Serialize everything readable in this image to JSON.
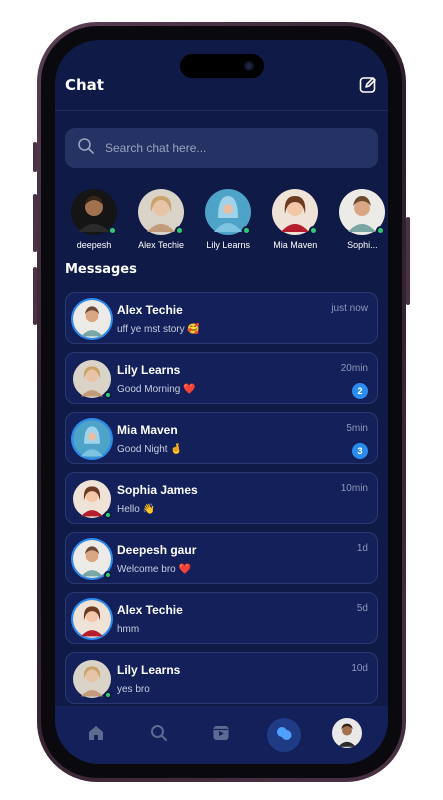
{
  "header": {
    "title": "Chat"
  },
  "search": {
    "placeholder": "Search chat here..."
  },
  "stories": [
    {
      "name": "deepesh",
      "online": true
    },
    {
      "name": "Alex Techie",
      "online": true
    },
    {
      "name": "Lily Learns",
      "online": true
    },
    {
      "name": "Mia Maven",
      "online": true
    },
    {
      "name": "Sophi...",
      "online": true
    }
  ],
  "messages_section": {
    "title": "Messages"
  },
  "messages": [
    {
      "name": "Alex Techie",
      "preview": "uff ye mst story 🥰",
      "time": "just now",
      "badge": ""
    },
    {
      "name": "Lily Learns",
      "preview": "Good Morning ❤️",
      "time": "20min",
      "badge": "2"
    },
    {
      "name": "Mia Maven",
      "preview": "Good Night 🤞",
      "time": "5min",
      "badge": "3"
    },
    {
      "name": "Sophia James",
      "preview": "Hello 👋",
      "time": "10min",
      "badge": ""
    },
    {
      "name": "Deepesh gaur",
      "preview": "Welcome bro ❤️",
      "time": "1d",
      "badge": ""
    },
    {
      "name": "Alex Techie",
      "preview": "hmm",
      "time": "5d",
      "badge": ""
    },
    {
      "name": "Lily Learns",
      "preview": "yes bro",
      "time": "10d",
      "badge": ""
    }
  ],
  "nav": [
    {
      "icon": "home-icon"
    },
    {
      "icon": "search-icon"
    },
    {
      "icon": "reels-icon"
    },
    {
      "icon": "chat-icon",
      "active": true
    },
    {
      "icon": "profile-avatar"
    }
  ],
  "colors": {
    "background": "#0f1a47",
    "card": "#13205a",
    "accent": "#2b8cf0",
    "online": "#2ecc71"
  }
}
